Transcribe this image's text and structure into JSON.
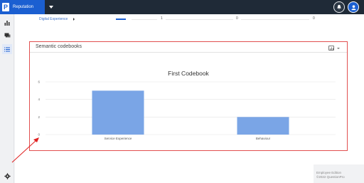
{
  "app": {
    "brand_letter": "P",
    "brand_label": "Reputation"
  },
  "table_row": {
    "name": "Digital Experience",
    "values": [
      "1",
      "0",
      "0"
    ],
    "progress_fraction": 0.15
  },
  "panel": {
    "title": "Semantic codebooks"
  },
  "chart_data": {
    "type": "bar",
    "title": "First Codebook",
    "categories": [
      "Service Experience",
      "Behaviour"
    ],
    "values": [
      5,
      2
    ],
    "ylim": [
      0,
      6
    ],
    "yticks": [
      "0",
      "2",
      "4",
      "6"
    ],
    "color": "#7aa5e6",
    "grid": true
  },
  "footer": {
    "line1": "Employee Edition",
    "line2": "©2022 QuestionPro"
  },
  "colors": {
    "accent": "#1b5fd1",
    "highlight_border": "#e25050",
    "topbar": "#1f2a37"
  },
  "icons": [
    "bar-chart-icon",
    "chat-icon",
    "list-icon",
    "gear-icon",
    "bell-icon",
    "user-icon",
    "chart-menu-icon"
  ]
}
